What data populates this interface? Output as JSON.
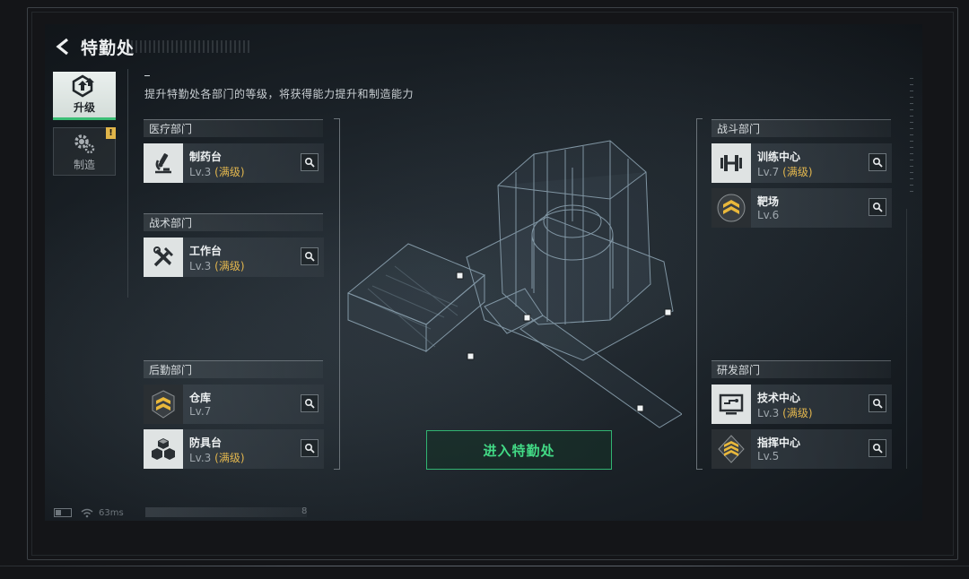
{
  "header": {
    "title": "特勤处"
  },
  "tabs": [
    {
      "label": "升级",
      "active": true,
      "icon": "upgrade-icon"
    },
    {
      "label": "制造",
      "active": false,
      "icon": "gear-icon",
      "badge": "!"
    }
  ],
  "subtitle": "提升特勤处各部门的等级，将获得能力提升和制造能力",
  "departments": {
    "medical": {
      "label": "医疗部门",
      "items": [
        {
          "name": "制药台",
          "level": "Lv.3",
          "max": "(满级)",
          "icon": "microscope-icon"
        }
      ]
    },
    "tactical": {
      "label": "战术部门",
      "items": [
        {
          "name": "工作台",
          "level": "Lv.3",
          "max": "(满级)",
          "icon": "tools-icon"
        }
      ]
    },
    "logistics": {
      "label": "后勤部门",
      "items": [
        {
          "name": "仓库",
          "level": "Lv.7",
          "max": "",
          "icon": "rank-chevron-icon"
        },
        {
          "name": "防具台",
          "level": "Lv.3",
          "max": "(满级)",
          "icon": "boxes-icon"
        }
      ]
    },
    "combat": {
      "label": "战斗部门",
      "items": [
        {
          "name": "训练中心",
          "level": "Lv.7",
          "max": "(满级)",
          "icon": "dumbbell-icon"
        },
        {
          "name": "靶场",
          "level": "Lv.6",
          "max": "",
          "icon": "rank-chevron-icon"
        }
      ]
    },
    "research": {
      "label": "研发部门",
      "items": [
        {
          "name": "技术中心",
          "level": "Lv.3",
          "max": "(满级)",
          "icon": "monitor-icon"
        },
        {
          "name": "指挥中心",
          "level": "Lv.5",
          "max": "",
          "icon": "rank-chevron-icon"
        }
      ]
    }
  },
  "enter_button": "进入特勤处",
  "status": {
    "ping": "63ms",
    "counter": "8"
  },
  "colors": {
    "accent_green": "#3bbf76",
    "max_gold": "#e2b64e",
    "badge_yellow": "#e0b54a"
  }
}
